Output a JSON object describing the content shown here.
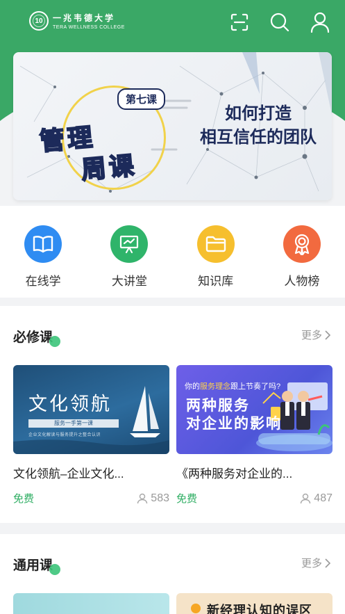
{
  "header": {
    "logo_cn": "一兆韦德大学",
    "logo_en": "TERA WELLNESS COLLEGE",
    "logo_badge": "10",
    "icons": [
      "scan-icon",
      "search-icon",
      "user-icon"
    ]
  },
  "banner": {
    "tag": "第七课",
    "title_line1": "管理",
    "title_line2": "周课",
    "subtitle_line1": "如何打造",
    "subtitle_line2": "相互信任的团队"
  },
  "quick_nav": [
    {
      "label": "在线学",
      "icon": "book-icon",
      "color": "#2f8cf2"
    },
    {
      "label": "大讲堂",
      "icon": "presentation-icon",
      "color": "#2fb46a"
    },
    {
      "label": "知识库",
      "icon": "folder-icon",
      "color": "#f6bf2e"
    },
    {
      "label": "人物榜",
      "icon": "medal-icon",
      "color": "#f26a3f"
    }
  ],
  "required": {
    "title": "必修课",
    "more": "更多",
    "courses": [
      {
        "title": "文化领航–企业文化...",
        "price": "免费",
        "count": "583",
        "image_title": "文化领航",
        "image_line": "服务一手第一课",
        "image_small": "企业文化解读与服务提升之整合认识"
      },
      {
        "title": "《两种服务对企业的...",
        "price": "免费",
        "count": "487",
        "image_top_a": "你的",
        "image_top_hl": "服务理念",
        "image_top_b": "跟上节奏了吗?",
        "image_line1": "两种服务",
        "image_line2": "对企业的影响"
      }
    ]
  },
  "general": {
    "title": "通用课",
    "more": "更多",
    "card2_text": "新经理认知的误区"
  },
  "colors": {
    "brand_green": "#3aa866",
    "accent_dot": "#3cc47a",
    "price_green": "#2fae63"
  }
}
